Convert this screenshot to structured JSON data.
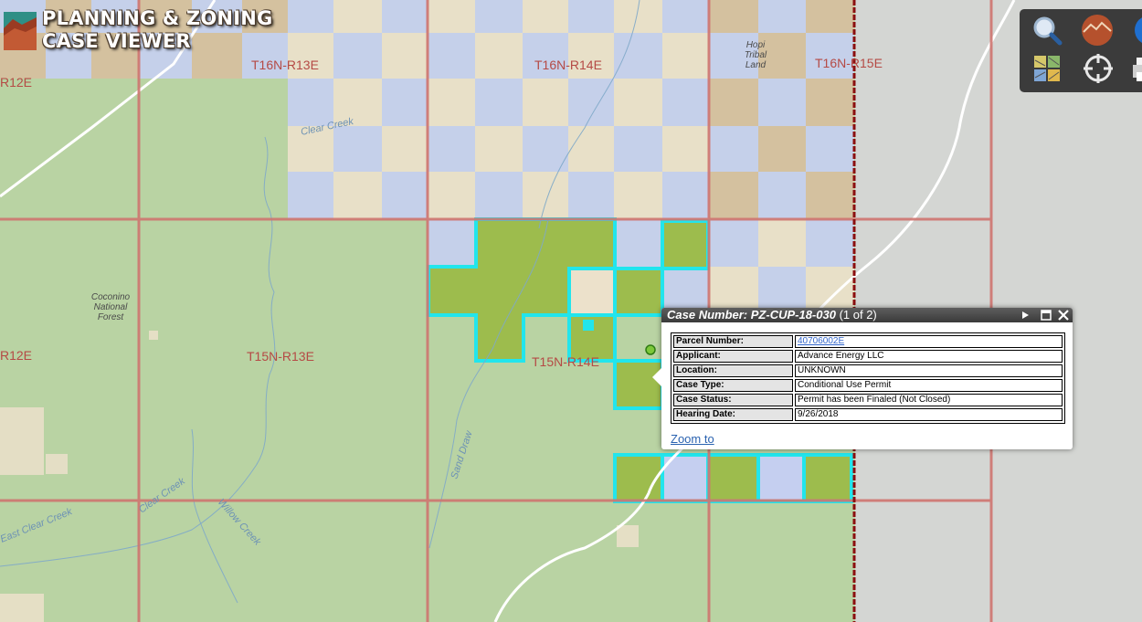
{
  "app": {
    "title_line1": "PLANNING & ZONING",
    "title_line2": "CASE VIEWER"
  },
  "toolbar": {
    "tools": [
      {
        "name": "search-tool",
        "icon": "magnifier-icon"
      },
      {
        "name": "basemap-tool",
        "icon": "terrain-globe-icon"
      },
      {
        "name": "globe-tool",
        "icon": "globe-icon"
      },
      {
        "name": "layers-tool",
        "icon": "map-tiles-icon"
      },
      {
        "name": "locate-tool",
        "icon": "crosshair-icon"
      },
      {
        "name": "print-tool",
        "icon": "printer-icon"
      }
    ]
  },
  "map": {
    "township_labels": [
      "T16N-R13E",
      "T16N-R14E",
      "T16N-R15E",
      "R12E",
      "R12E",
      "T15N-R13E",
      "T15N-R14E"
    ],
    "place_labels": {
      "hopi_1": "Hopi",
      "hopi_2": "Tribal",
      "hopi_3": "Land",
      "coconino_1": "Coconino",
      "coconino_2": "National",
      "coconino_3": "Forest"
    },
    "creek_labels": [
      "Clear Creek",
      "Sand Draw",
      "Clear Creek",
      "Willow Creek",
      "East Clear Creek"
    ],
    "colors": {
      "forest": "#b9d3a3",
      "state_trust": "#c5cff0",
      "private": "#ece1cb",
      "tribal": "#d6bf9e",
      "parcel_fill": "#9dbc4d",
      "parcel_outline": "#22e5ec",
      "grid_line": "#cf7570",
      "county_line": "#8b0f0f"
    }
  },
  "popup": {
    "title": "Case Number: PZ-CUP-18-030",
    "count": "(1 of 2)",
    "rows": [
      {
        "label": "Parcel Number:",
        "value": "40706002E",
        "is_link": true
      },
      {
        "label": "Applicant:",
        "value": "Advance Energy LLC"
      },
      {
        "label": "Location:",
        "value": "UNKNOWN"
      },
      {
        "label": "Case Type:",
        "value": "Conditional Use Permit"
      },
      {
        "label": "Case Status:",
        "value": "Permit has been Finaled (Not Closed)"
      },
      {
        "label": "Hearing Date:",
        "value": "9/26/2018"
      }
    ],
    "zoom_label": "Zoom to"
  }
}
